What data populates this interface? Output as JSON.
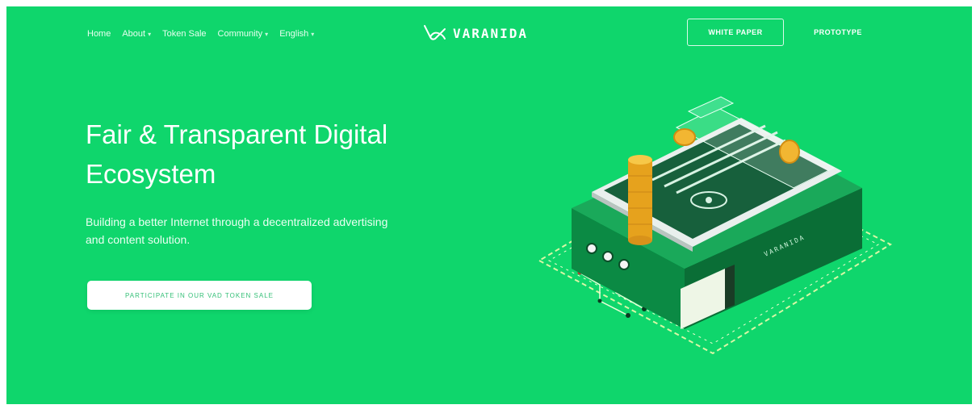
{
  "nav": {
    "items": [
      {
        "label": "Home",
        "has_caret": false
      },
      {
        "label": "About",
        "has_caret": true
      },
      {
        "label": "Token Sale",
        "has_caret": false
      },
      {
        "label": "Community",
        "has_caret": true
      },
      {
        "label": "English",
        "has_caret": true
      }
    ],
    "caret": "▾"
  },
  "logo": {
    "text": "VARANIDA"
  },
  "buttons": {
    "white_paper": "WHITE PAPER",
    "prototype": "PROTOTYPE"
  },
  "hero": {
    "title_line1": "Fair & Transparent Digital",
    "title_line2": "Ecosystem",
    "subtitle_line1": "Building a better Internet through a decentralized advertising",
    "subtitle_line2": "and content solution.",
    "cta": "PARTICIPATE IN OUR VAD TOKEN SALE"
  },
  "illustration": {
    "device_label": "VARANIDA"
  },
  "colors": {
    "background": "#0fd66c",
    "dark_green": "#0b7a3e",
    "coin": "#f2b632",
    "white": "#ffffff"
  }
}
